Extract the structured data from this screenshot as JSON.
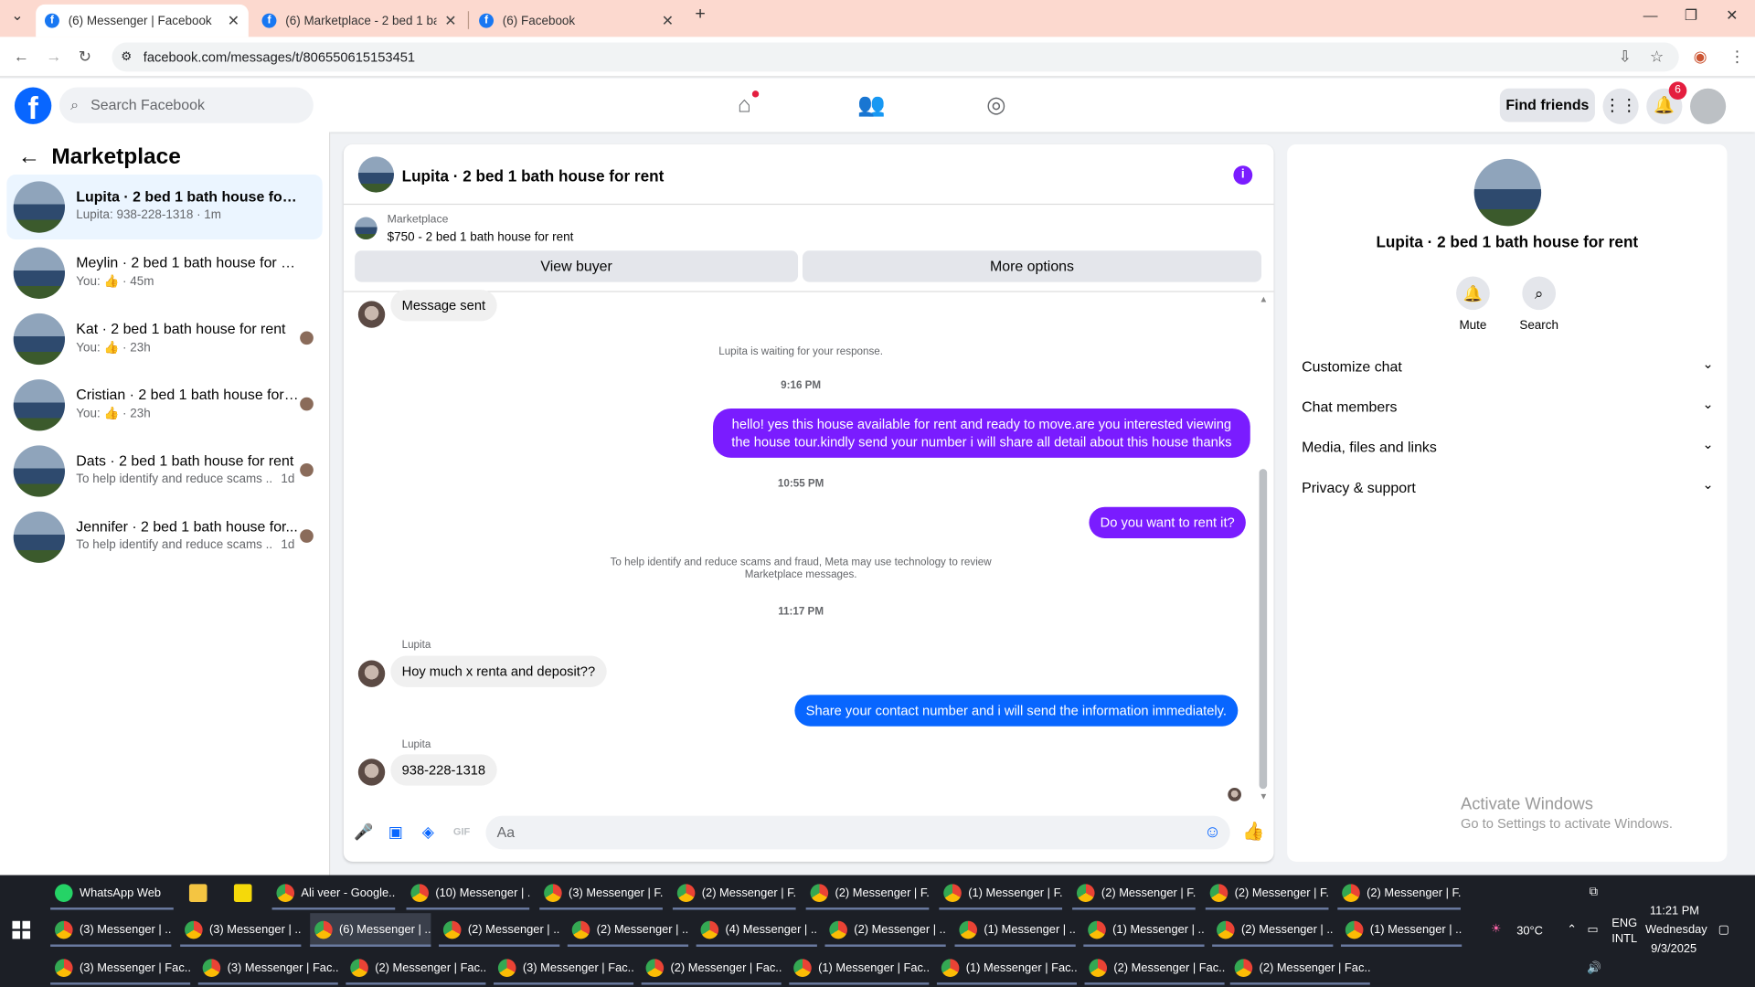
{
  "browser": {
    "tabs": [
      {
        "label": "(6) Messenger | Facebook"
      },
      {
        "label": "(6) Marketplace - 2 bed 1 bath h"
      },
      {
        "label": "(6) Facebook"
      }
    ],
    "url": "facebook.com/messages/t/806550615153451"
  },
  "fb": {
    "search_placeholder": "Search Facebook",
    "find_friends": "Find friends",
    "notifications_badge": "6"
  },
  "left": {
    "title": "Marketplace",
    "conversations": [
      {
        "name": "Lupita · 2 bed 1 bath house for rent",
        "sub": "Lupita: 938-228-1318 · 1m",
        "ago": ""
      },
      {
        "name": "Meylin · 2 bed 1 bath house for rent",
        "sub": "You: 👍 · 45m",
        "ago": ""
      },
      {
        "name": "Kat · 2 bed 1 bath house for rent",
        "sub": "You: 👍 · 23h",
        "ago": ""
      },
      {
        "name": "Cristian · 2 bed 1 bath house for ...",
        "sub": "You: 👍 · 23h",
        "ago": ""
      },
      {
        "name": "Dats · 2 bed 1 bath house for rent",
        "sub": "To help identify and reduce scams ...",
        "ago": "1d"
      },
      {
        "name": "Jennifer · 2 bed 1 bath house for...",
        "sub": "To help identify and reduce scams ...",
        "ago": "1d"
      }
    ]
  },
  "chat": {
    "title": "Lupita · 2 bed 1 bath house for rent",
    "market_label": "Marketplace",
    "listing": "$750 - 2 bed 1 bath house for rent",
    "view_buyer": "View buyer",
    "more_options": "More options",
    "msg_sent": "Message sent",
    "waiting": "Lupita is waiting for your response.",
    "time1": "9:16 PM",
    "out1": "hello! yes this house available for rent and ready to move.are you interested viewing the house tour.kindly send your number i will share all detail about this house thanks",
    "time2": "10:55 PM",
    "out2": "Do you want to rent it?",
    "scam_notice": "To help identify and reduce scams and fraud, Meta may use technology to review Marketplace messages.",
    "time3": "11:17 PM",
    "sender": "Lupita",
    "in1": "Hoy much x renta and deposit??",
    "out3": "Share your contact number and i will send the information immediately.",
    "in2": "938-228-1318",
    "input_placeholder": "Aa"
  },
  "right": {
    "name": "Lupita · 2 bed 1 bath house for rent",
    "mute": "Mute",
    "search": "Search",
    "rows": [
      "Customize chat",
      "Chat members",
      "Media, files and links",
      "Privacy & support"
    ],
    "activate1": "Activate Windows",
    "activate2": "Go to Settings to activate Windows."
  },
  "taskbar": {
    "row1": [
      "WhatsApp Web",
      "",
      "",
      "Ali veer - Google...",
      "(10) Messenger | ...",
      "(3) Messenger | F...",
      "(2) Messenger | F...",
      "(2) Messenger | F...",
      "(1) Messenger | F...",
      "(2) Messenger | F...",
      "(2) Messenger | F...",
      "(2) Messenger | F..."
    ],
    "row2": [
      "(3) Messenger | ...",
      "(3) Messenger | ...",
      "(6) Messenger | ...",
      "(2) Messenger | ...",
      "(2) Messenger | ...",
      "(4) Messenger | ...",
      "(2) Messenger | ...",
      "(1) Messenger | ...",
      "(1) Messenger | ...",
      "(2) Messenger | ...",
      "(1) Messenger | ..."
    ],
    "row3": [
      "(3) Messenger | Fac...",
      "(3) Messenger | Fac...",
      "(2) Messenger | Fac...",
      "(3) Messenger | Fac...",
      "(2) Messenger | Fac...",
      "(1) Messenger | Fac...",
      "(1) Messenger | Fac...",
      "(2) Messenger | Fac...",
      "(2) Messenger | Fac..."
    ],
    "temp": "30°C",
    "lang1": "ENG",
    "lang2": "INTL",
    "time": "11:21 PM",
    "day": "Wednesday",
    "date": "9/3/2025"
  }
}
